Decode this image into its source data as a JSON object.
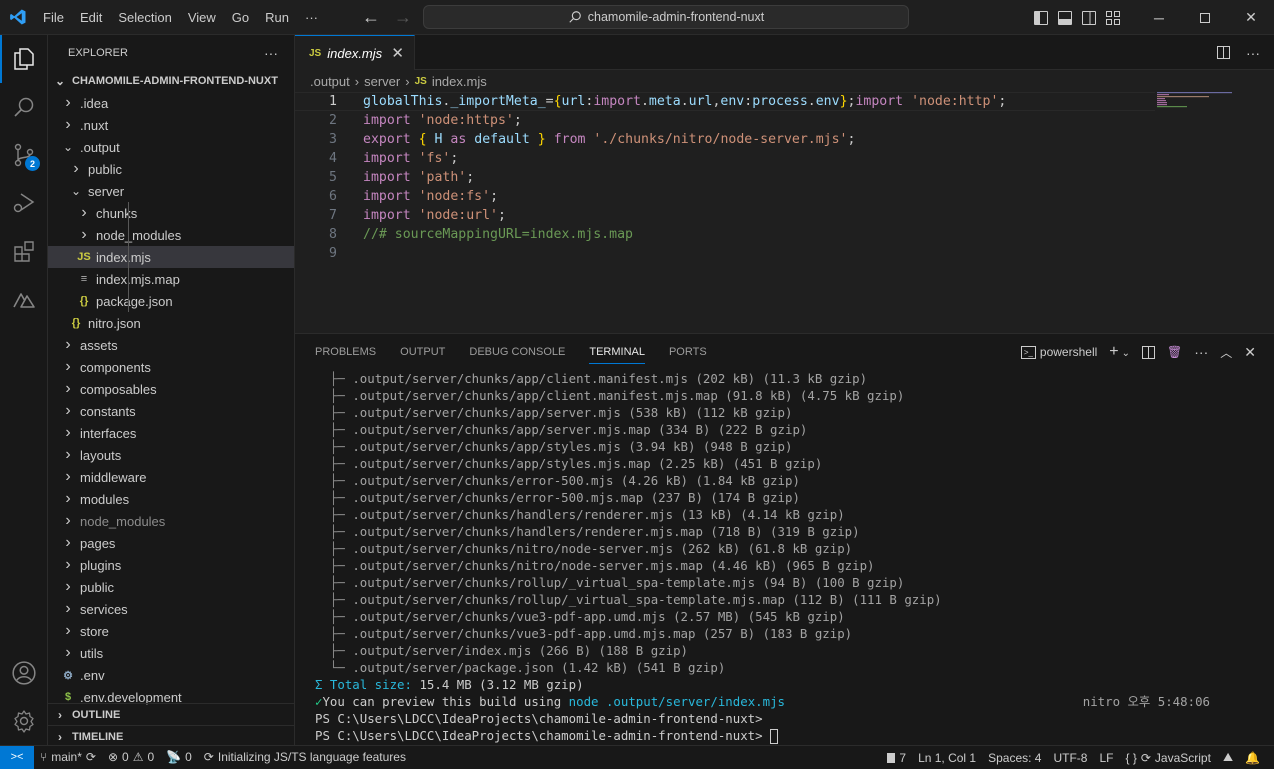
{
  "titlebar": {
    "menu": [
      "File",
      "Edit",
      "Selection",
      "View",
      "Go",
      "Run",
      "···"
    ],
    "search": "chamomile-admin-frontend-nuxt",
    "window_controls": [
      "minimize",
      "maximize",
      "close"
    ]
  },
  "activitybar": {
    "items": [
      "explorer",
      "search",
      "source-control",
      "run-debug",
      "extensions",
      "nuxt"
    ],
    "source_control_badge": "2",
    "bottom": [
      "accounts",
      "manage"
    ]
  },
  "sidebar": {
    "title": "EXPLORER",
    "more": "···",
    "root": "CHAMOMILE-ADMIN-FRONTEND-NUXT",
    "tree": [
      {
        "label": ".idea",
        "type": "folder",
        "expanded": false,
        "depth": 1
      },
      {
        "label": ".nuxt",
        "type": "folder",
        "expanded": false,
        "depth": 1
      },
      {
        "label": ".output",
        "type": "folder",
        "expanded": true,
        "depth": 1
      },
      {
        "label": "public",
        "type": "folder",
        "expanded": false,
        "depth": 2
      },
      {
        "label": "server",
        "type": "folder",
        "expanded": true,
        "depth": 2
      },
      {
        "label": "chunks",
        "type": "folder",
        "expanded": false,
        "depth": 3
      },
      {
        "label": "node_modules",
        "type": "folder",
        "expanded": false,
        "depth": 3
      },
      {
        "label": "index.mjs",
        "type": "js",
        "depth": 3,
        "selected": true
      },
      {
        "label": "index.mjs.map",
        "type": "map",
        "depth": 3
      },
      {
        "label": "package.json",
        "type": "json",
        "depth": 3
      },
      {
        "label": "nitro.json",
        "type": "json",
        "depth": 2
      },
      {
        "label": "assets",
        "type": "folder",
        "expanded": false,
        "depth": 1
      },
      {
        "label": "components",
        "type": "folder",
        "expanded": false,
        "depth": 1
      },
      {
        "label": "composables",
        "type": "folder",
        "expanded": false,
        "depth": 1
      },
      {
        "label": "constants",
        "type": "folder",
        "expanded": false,
        "depth": 1
      },
      {
        "label": "interfaces",
        "type": "folder",
        "expanded": false,
        "depth": 1
      },
      {
        "label": "layouts",
        "type": "folder",
        "expanded": false,
        "depth": 1
      },
      {
        "label": "middleware",
        "type": "folder",
        "expanded": false,
        "depth": 1
      },
      {
        "label": "modules",
        "type": "folder",
        "expanded": false,
        "depth": 1
      },
      {
        "label": "node_modules",
        "type": "folder",
        "expanded": false,
        "depth": 1,
        "dim": true
      },
      {
        "label": "pages",
        "type": "folder",
        "expanded": false,
        "depth": 1
      },
      {
        "label": "plugins",
        "type": "folder",
        "expanded": false,
        "depth": 1
      },
      {
        "label": "public",
        "type": "folder",
        "expanded": false,
        "depth": 1
      },
      {
        "label": "services",
        "type": "folder",
        "expanded": false,
        "depth": 1
      },
      {
        "label": "store",
        "type": "folder",
        "expanded": false,
        "depth": 1
      },
      {
        "label": "utils",
        "type": "folder",
        "expanded": false,
        "depth": 1
      },
      {
        "label": ".env",
        "type": "env",
        "depth": 1
      },
      {
        "label": ".env.development",
        "type": "envdev",
        "depth": 1
      }
    ],
    "outline": "OUTLINE",
    "timeline": "TIMELINE"
  },
  "editor": {
    "tab": {
      "icon": "JS",
      "label": "index.mjs"
    },
    "breadcrumb": [
      ".output",
      "server",
      "index.mjs"
    ],
    "lines": [
      "globalThis._importMeta_={url:import.meta.url,env:process.env};import 'node:http';",
      "import 'node:https';",
      "export { H as default } from './chunks/nitro/node-server.mjs';",
      "import 'fs';",
      "import 'path';",
      "import 'node:fs';",
      "import 'node:url';",
      "//# sourceMappingURL=index.mjs.map",
      ""
    ],
    "current_line": 1
  },
  "panel": {
    "tabs": [
      "PROBLEMS",
      "OUTPUT",
      "DEBUG CONSOLE",
      "TERMINAL",
      "PORTS"
    ],
    "active_tab": "TERMINAL",
    "shell": "powershell",
    "terminal": {
      "files": [
        ".output/server/chunks/app/client.manifest.mjs (202 kB) (11.3 kB gzip)",
        ".output/server/chunks/app/client.manifest.mjs.map (91.8 kB) (4.75 kB gzip)",
        ".output/server/chunks/app/server.mjs (538 kB) (112 kB gzip)",
        ".output/server/chunks/app/server.mjs.map (334 B) (222 B gzip)",
        ".output/server/chunks/app/styles.mjs (3.94 kB) (948 B gzip)",
        ".output/server/chunks/app/styles.mjs.map (2.25 kB) (451 B gzip)",
        ".output/server/chunks/error-500.mjs (4.26 kB) (1.84 kB gzip)",
        ".output/server/chunks/error-500.mjs.map (237 B) (174 B gzip)",
        ".output/server/chunks/handlers/renderer.mjs (13 kB) (4.14 kB gzip)",
        ".output/server/chunks/handlers/renderer.mjs.map (718 B) (319 B gzip)",
        ".output/server/chunks/nitro/node-server.mjs (262 kB) (61.8 kB gzip)",
        ".output/server/chunks/nitro/node-server.mjs.map (4.46 kB) (965 B gzip)",
        ".output/server/chunks/rollup/_virtual_spa-template.mjs (94 B) (100 B gzip)",
        ".output/server/chunks/rollup/_virtual_spa-template.mjs.map (112 B) (111 B gzip)",
        ".output/server/chunks/vue3-pdf-app.umd.mjs (2.57 MB) (545 kB gzip)",
        ".output/server/chunks/vue3-pdf-app.umd.mjs.map (257 B) (183 B gzip)",
        ".output/server/index.mjs (266 B) (188 B gzip)",
        ".output/server/package.json (1.42 kB) (541 B gzip)"
      ],
      "total_label": "Σ Total size:",
      "total_value": " 15.4 MB (3.12 MB gzip)",
      "preview_check": "✓",
      "preview_text": "You can preview this build using ",
      "preview_cmd": "node .output/server/index.mjs",
      "timestamp": "nitro 오후 5:48:06",
      "prompt1": "PS C:\\Users\\LDCC\\IdeaProjects\\chamomile-admin-frontend-nuxt>",
      "prompt2": "PS C:\\Users\\LDCC\\IdeaProjects\\chamomile-admin-frontend-nuxt> "
    }
  },
  "statusbar": {
    "branch": "main*",
    "errors": "0",
    "warnings": "0",
    "ports": "0",
    "task": "Initializing JS/TS language features",
    "problems_count": "7",
    "cursor": "Ln 1, Col 1",
    "spaces": "Spaces: 4",
    "encoding": "UTF-8",
    "eol": "LF",
    "language": "JavaScript"
  },
  "colors": {
    "accent": "#0078d4",
    "js_icon": "#cbcb41",
    "keyword": "#c586c0",
    "string": "#ce9178",
    "comment": "#6a9955"
  }
}
